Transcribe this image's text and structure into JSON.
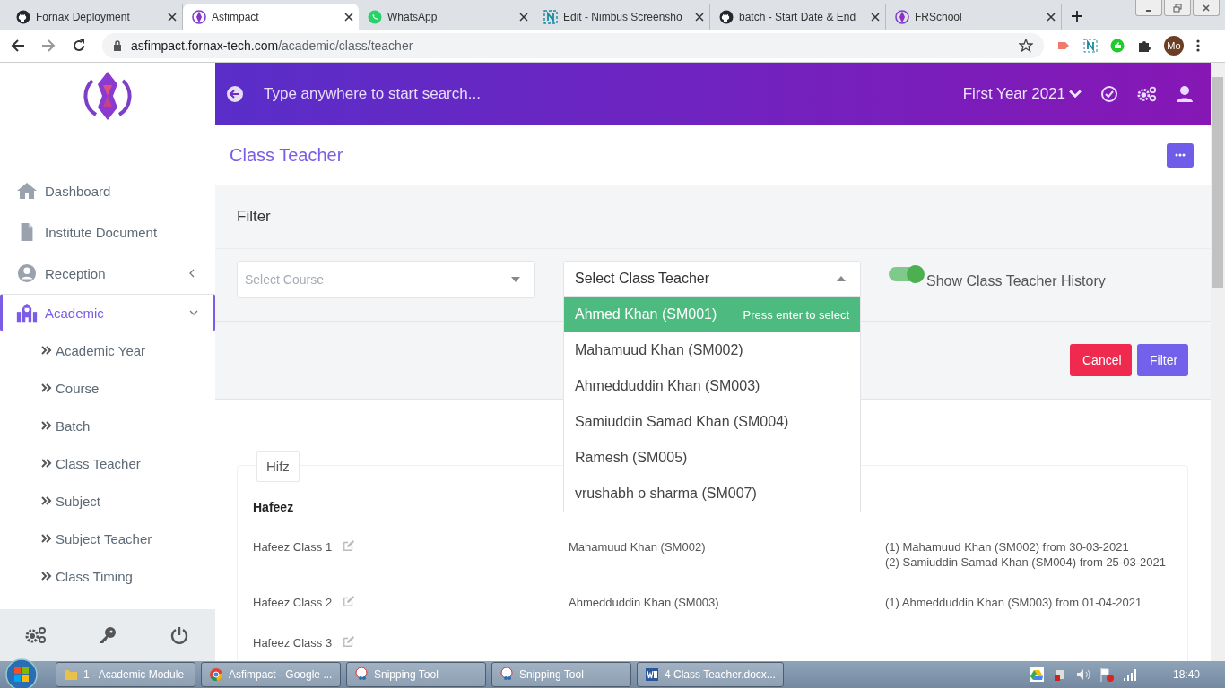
{
  "browser": {
    "tabs": [
      {
        "title": "Fornax Deployment",
        "selected": false
      },
      {
        "title": "Asfimpact",
        "selected": true
      },
      {
        "title": "WhatsApp",
        "selected": false
      },
      {
        "title": "Edit - Nimbus Screensho",
        "selected": false
      },
      {
        "title": "batch - Start Date & End",
        "selected": false
      },
      {
        "title": "FRSchool",
        "selected": false
      }
    ],
    "url": {
      "host": "asfimpact.fornax-tech.com",
      "path": "/academic/class/teacher"
    },
    "profile": "Mo"
  },
  "sidebar": {
    "items": [
      {
        "label": "Dashboard",
        "selected": false
      },
      {
        "label": "Institute Document",
        "selected": false
      },
      {
        "label": "Reception",
        "selected": false,
        "expanded": false
      },
      {
        "label": "Academic",
        "selected": true,
        "expanded": true,
        "children": [
          {
            "label": "Academic Year"
          },
          {
            "label": "Course"
          },
          {
            "label": "Batch"
          },
          {
            "label": "Class Teacher"
          },
          {
            "label": "Subject"
          },
          {
            "label": "Subject Teacher"
          },
          {
            "label": "Class Timing"
          }
        ]
      }
    ]
  },
  "header": {
    "search_placeholder": "Type anywhere to start search...",
    "year": "First Year 2021"
  },
  "page_title": "Class Teacher",
  "filter": {
    "title": "Filter",
    "course_placeholder": "Select Course",
    "teacher_placeholder": "Select Class Teacher",
    "toggle": {
      "label": "Show Class Teacher History",
      "on": true
    },
    "options": [
      {
        "label": "Ahmed Khan (SM001)",
        "selected": true
      },
      {
        "label": "Mahamuud Khan (SM002)",
        "selected": false
      },
      {
        "label": "Ahmedduddin Khan (SM003)",
        "selected": false
      },
      {
        "label": "Samiuddin Samad Khan (SM004)",
        "selected": false
      },
      {
        "label": "Ramesh (SM005)",
        "selected": false
      },
      {
        "label": "vrushabh o sharma (SM007)",
        "selected": false
      }
    ],
    "option_hint": "Press enter to select",
    "cancel": "Cancel",
    "submit": "Filter"
  },
  "group": {
    "legend": "Hifz",
    "sections": [
      {
        "title": "Hafeez",
        "rows": [
          {
            "class": "Hafeez Class 1",
            "teacher": "Mahamuud Khan (SM002)",
            "history": [
              "(1) Mahamuud Khan (SM002) from 30-03-2021",
              "(2) Samiuddin Samad Khan (SM004) from 25-03-2021"
            ]
          },
          {
            "class": "Hafeez Class 2",
            "teacher": "Ahmedduddin Khan (SM003)",
            "history": [
              "(1) Ahmedduddin Khan (SM003) from 01-04-2021"
            ]
          },
          {
            "class": "Hafeez Class 3"
          }
        ]
      }
    ]
  },
  "taskbar": {
    "items": [
      {
        "label": "1 - Academic Module"
      },
      {
        "label": "Asfimpact - Google ..."
      },
      {
        "label": "Snipping Tool"
      },
      {
        "label": "Snipping Tool"
      },
      {
        "label": "4 Class Teacher.docx..."
      }
    ],
    "clock": "18:40"
  }
}
